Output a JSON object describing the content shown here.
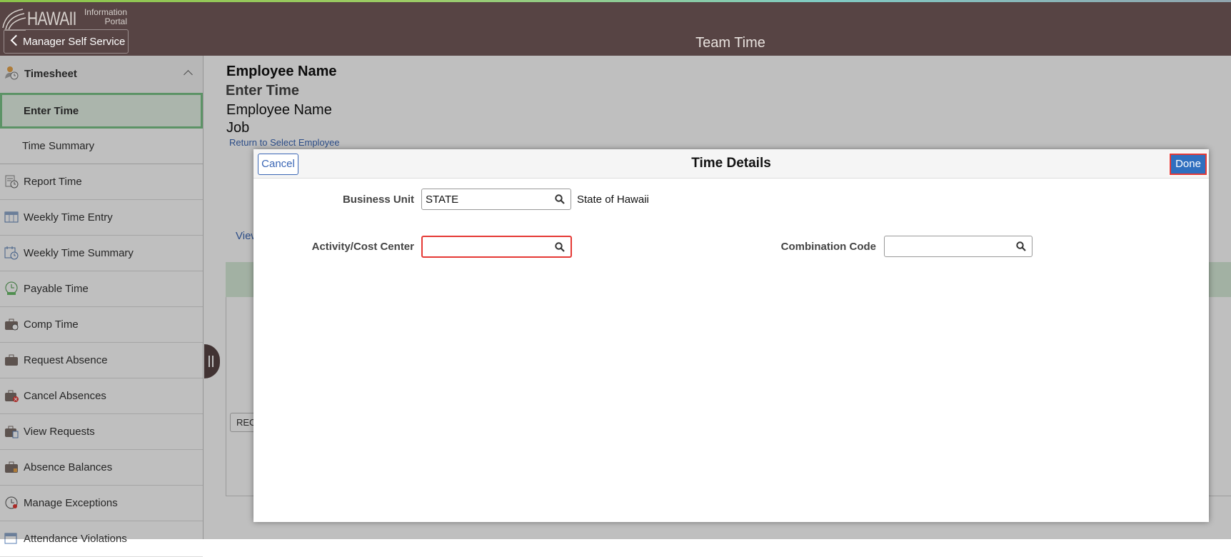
{
  "header": {
    "logo_main": "HAWAII",
    "logo_sub_line1": "Information",
    "logo_sub_line2": "Portal",
    "back_label": "Manager Self Service",
    "title": "Team Time"
  },
  "sidebar": {
    "group_label": "Timesheet",
    "selected_item": "Enter Time",
    "sub_item": "Time Summary",
    "items": [
      {
        "label": "Report Time",
        "icon": "clock-report-icon"
      },
      {
        "label": "Weekly Time Entry",
        "icon": "calendar-grid-icon"
      },
      {
        "label": "Weekly Time Summary",
        "icon": "calendar-clock-icon"
      },
      {
        "label": "Payable Time",
        "icon": "clock-money-icon"
      },
      {
        "label": "Comp Time",
        "icon": "briefcase-clock-icon"
      },
      {
        "label": "Request Absence",
        "icon": "briefcase-icon"
      },
      {
        "label": "Cancel Absences",
        "icon": "briefcase-cancel-icon"
      },
      {
        "label": "View Requests",
        "icon": "briefcase-list-icon"
      },
      {
        "label": "Absence Balances",
        "icon": "briefcase-balance-icon"
      },
      {
        "label": "Manage Exceptions",
        "icon": "clock-exception-icon"
      },
      {
        "label": "Attendance Violations",
        "icon": "calendar-violation-icon"
      }
    ]
  },
  "content": {
    "employee_heading": "Employee Name",
    "enter_time_heading": "Enter Time",
    "employee_name": "Employee Name",
    "job": "Job",
    "return_link": "Return to Select Employee",
    "view_link": "View",
    "rec_button": "REC"
  },
  "modal": {
    "title": "Time Details",
    "cancel_label": "Cancel",
    "done_label": "Done",
    "business_unit": {
      "label": "Business Unit",
      "value": "STATE",
      "description": "State of Hawaii"
    },
    "activity_cost_center": {
      "label": "Activity/Cost Center",
      "value": ""
    },
    "combination_code": {
      "label": "Combination Code",
      "value": ""
    }
  },
  "colors": {
    "header_bg": "#574444",
    "selected_bg": "#e4f2e6",
    "selected_border": "#7bc588",
    "error_border": "#e53935",
    "primary_button": "#2f6fbf",
    "link": "#3a66b5"
  }
}
